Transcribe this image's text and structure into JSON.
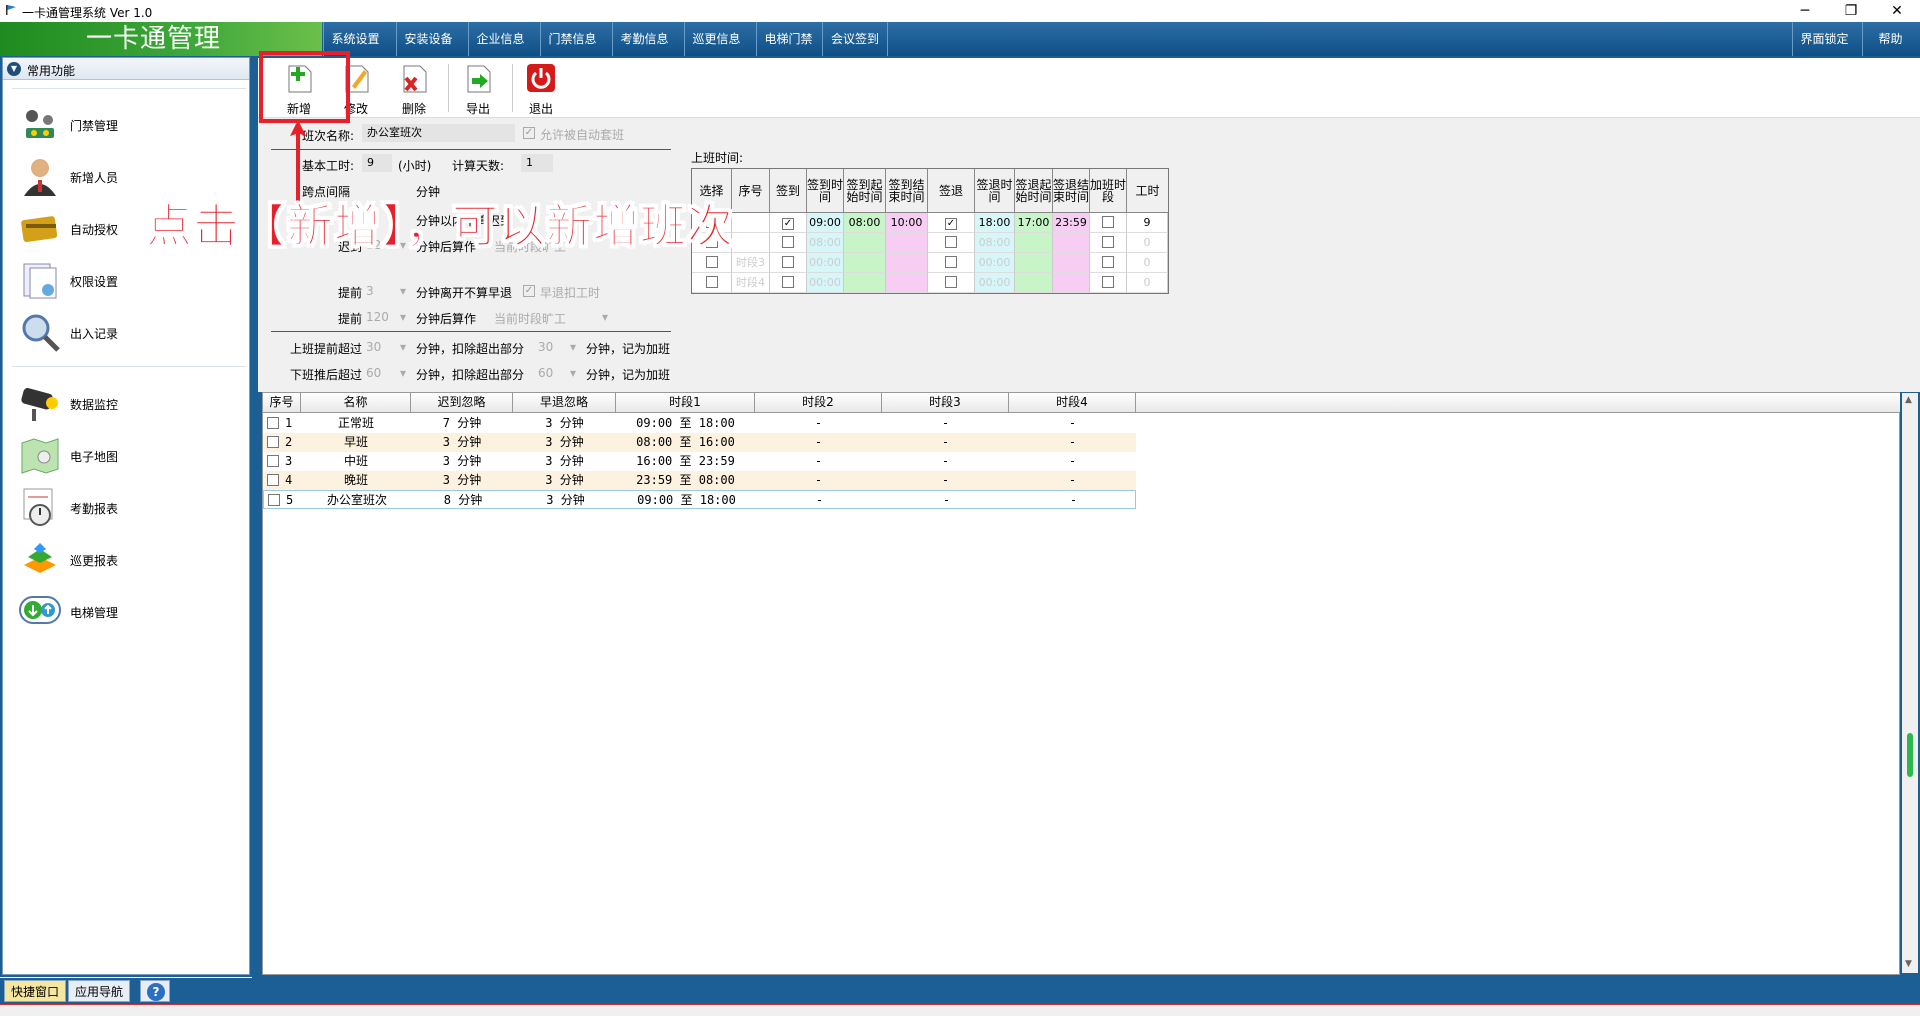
{
  "window": {
    "title": "一卡通管理系统  Ver 1.0",
    "minimize": "─",
    "restore": "❐",
    "close": "✕"
  },
  "brand": "一卡通管理",
  "menu": [
    "系统设置",
    "安装设备",
    "企业信息",
    "门禁信息",
    "考勤信息",
    "巡更信息",
    "电梯门禁",
    "会议签到"
  ],
  "menu_right": [
    "界面锁定",
    "帮助"
  ],
  "left_panel": {
    "header": "常用功能",
    "items": [
      "门禁管理",
      "新增人员",
      "自动授权",
      "权限设置",
      "出入记录",
      "数据监控",
      "电子地图",
      "考勤报表",
      "巡更报表",
      "电梯管理"
    ],
    "tabs": [
      "快捷窗口",
      "应用导航",
      "?"
    ]
  },
  "toolbar": {
    "add": "新增",
    "edit": "修改",
    "delete": "删除",
    "export": "导出",
    "exit": "退出"
  },
  "form": {
    "shift_name_label": "班次名称:",
    "shift_name_value": "办公室班次",
    "auto_shift_label": "允许被自动套班",
    "work_hours_label": "基本工时:",
    "work_hours_value": "9",
    "work_hours_unit": "(小时)",
    "calc_days_label": "计算天数:",
    "calc_days_value": "1",
    "cross_label": "跨点间隔",
    "minute": "分钟",
    "late_ignore_text": "分钟以内不算迟到",
    "late_label": "迟到",
    "late_value": "120",
    "late_after": "分钟后算作",
    "late_result": "当前时段旷工",
    "early_label": "提前",
    "early_value": "3",
    "early_text": "分钟离开不算早退",
    "early_deduct": "早退扣工时",
    "early2_label": "提前",
    "early2_value": "120",
    "early2_after": "分钟后算作",
    "early2_result": "当前时段旷工",
    "ot_before_label": "上班提前超过",
    "ot_before_value": "30",
    "ot_before_text": "分钟，扣除超出部分",
    "ot_before_value2": "30",
    "ot_before_tail": "分钟，记为加班",
    "ot_after_label": "下班推后超过",
    "ot_after_value": "60",
    "ot_after_text": "分钟，扣除超出部分",
    "ot_after_value2": "60",
    "ot_after_tail": "分钟，记为加班",
    "work_time_label": "上班时间:"
  },
  "shift_grid": {
    "headers": [
      "选择",
      "序号",
      "签到",
      "签到时间",
      "签到起始时间",
      "签到结束时间",
      "签退",
      "签退时间",
      "签退起始时间",
      "签退结束时间",
      "加班时段",
      "工时"
    ],
    "rows": [
      {
        "sel": false,
        "no": "",
        "in": true,
        "in_time": "09:00",
        "in_start": "08:00",
        "in_end": "10:00",
        "out": true,
        "out_time": "18:00",
        "out_start": "17:00",
        "out_end": "23:59",
        "ot": false,
        "hours": "9"
      },
      {
        "sel": false,
        "no": "",
        "in": false,
        "in_time": "08:00",
        "in_start": "",
        "in_end": "",
        "out": false,
        "out_time": "08:00",
        "out_start": "",
        "out_end": "",
        "ot": false,
        "hours": "0"
      },
      {
        "sel": false,
        "no": "时段3",
        "in": false,
        "in_time": "00:00",
        "in_start": "",
        "in_end": "",
        "out": false,
        "out_time": "00:00",
        "out_start": "",
        "out_end": "",
        "ot": false,
        "hours": "0"
      },
      {
        "sel": false,
        "no": "时段4",
        "in": false,
        "in_time": "00:00",
        "in_start": "",
        "in_end": "",
        "out": false,
        "out_time": "00:00",
        "out_start": "",
        "out_end": "",
        "ot": false,
        "hours": "0"
      }
    ]
  },
  "table": {
    "headers": [
      "序号",
      "名称",
      "迟到忽略",
      "早退忽略",
      "时段1",
      "时段2",
      "时段3",
      "时段4"
    ],
    "rows": [
      {
        "no": "1",
        "name": "正常班",
        "late": "7 分钟",
        "early": "3 分钟",
        "p1": "09:00 至 18:00",
        "p2": "-",
        "p3": "-",
        "p4": "-"
      },
      {
        "no": "2",
        "name": "早班",
        "late": "3 分钟",
        "early": "3 分钟",
        "p1": "08:00 至 16:00",
        "p2": "-",
        "p3": "-",
        "p4": "-"
      },
      {
        "no": "3",
        "name": "中班",
        "late": "3 分钟",
        "early": "3 分钟",
        "p1": "16:00 至 23:59",
        "p2": "-",
        "p3": "-",
        "p4": "-"
      },
      {
        "no": "4",
        "name": "晚班",
        "late": "3 分钟",
        "early": "3 分钟",
        "p1": "23:59 至 08:00",
        "p2": "-",
        "p3": "-",
        "p4": "-"
      },
      {
        "no": "5",
        "name": "办公室班次",
        "late": "8 分钟",
        "early": "3 分钟",
        "p1": "09:00 至 18:00",
        "p2": "-",
        "p3": "-",
        "p4": "-"
      }
    ]
  },
  "annotation": "点击【新增】，可以新增班次",
  "colors": {
    "accent": "#1c5f95",
    "annotation": "#e8202a",
    "brand_green": "#3fa83a"
  }
}
